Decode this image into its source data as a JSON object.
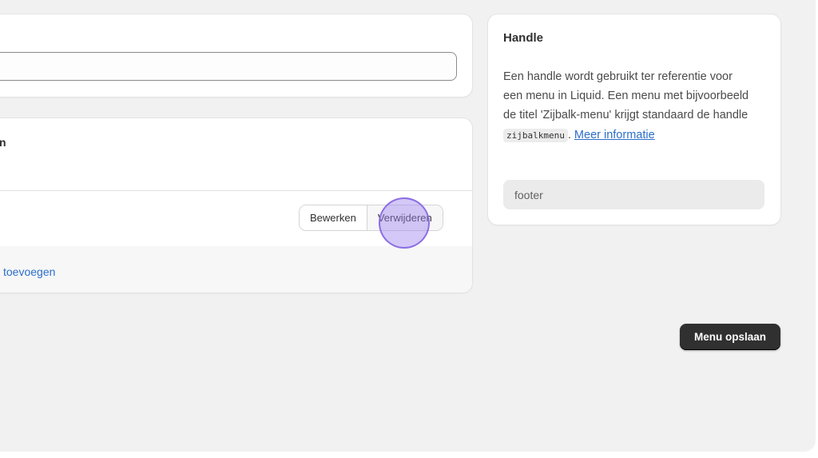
{
  "title_card": {
    "title_value": ""
  },
  "items_card": {
    "label_fragment": "n",
    "edit_label": "Bewerken",
    "delete_label": "Verwijderen",
    "add_item_label": "toevoegen"
  },
  "handle_card": {
    "heading": "Handle",
    "desc_part1": "Een handle wordt gebruikt ter referentie voor een menu in Liquid. Een menu met bijvoorbeeld de titel 'Zijbalk-menu' krijgt standaard de handle ",
    "code": "zijbalkmenu",
    "desc_part2": ". ",
    "link_label": "Meer informatie",
    "handle_value": "footer"
  },
  "save_label": "Menu opslaan",
  "colors": {
    "accent_link": "#2c6ecb",
    "primary_button": "#303030",
    "page_background": "#f1f1f1",
    "click_marker": "#9d84ee"
  }
}
